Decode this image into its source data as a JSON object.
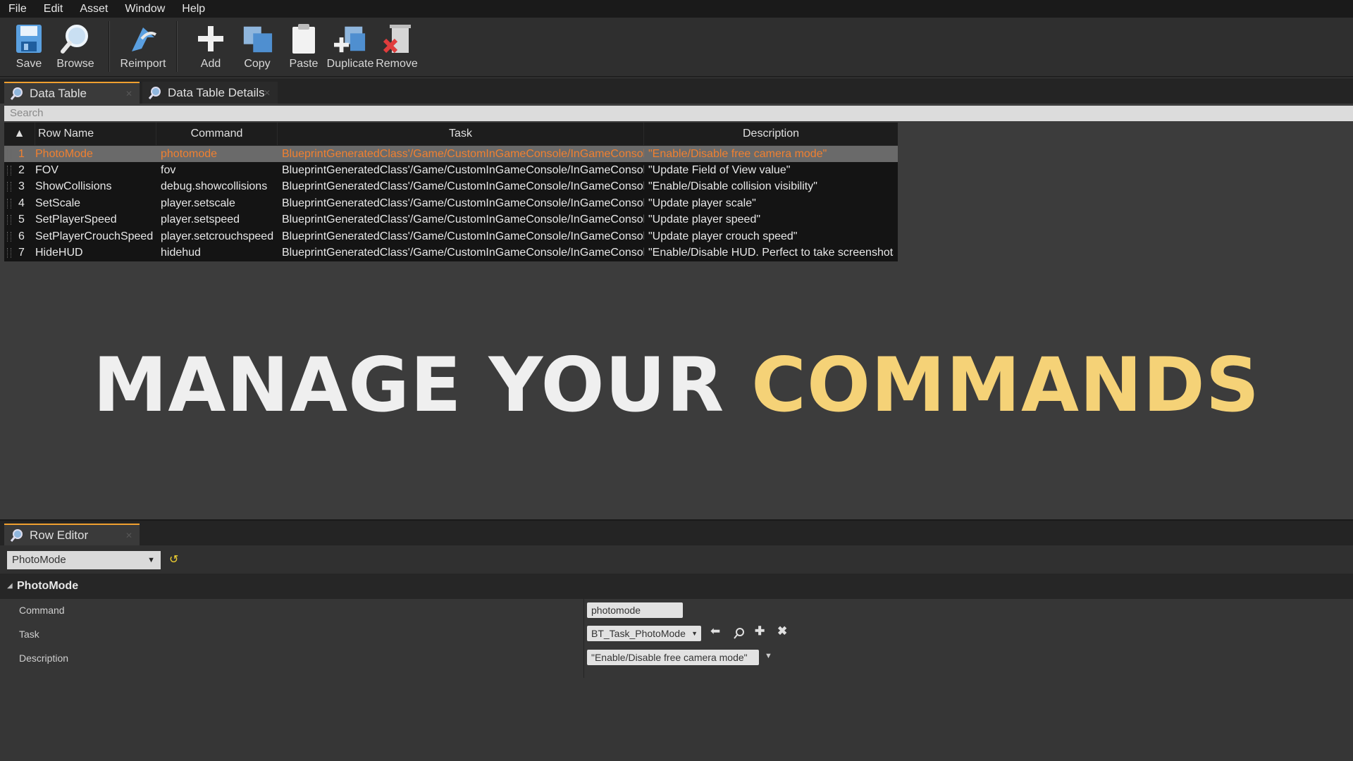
{
  "menu": [
    "File",
    "Edit",
    "Asset",
    "Window",
    "Help"
  ],
  "toolbar": {
    "save": "Save",
    "browse": "Browse",
    "reimport": "Reimport",
    "add": "Add",
    "copy": "Copy",
    "paste": "Paste",
    "duplicate": "Duplicate",
    "remove": "Remove"
  },
  "tabs": {
    "data_table": "Data Table",
    "data_table_details": "Data Table Details"
  },
  "search": {
    "placeholder": "Search"
  },
  "table": {
    "headers": [
      "Row Name",
      "Command",
      "Task",
      "Description"
    ],
    "rows": [
      {
        "n": "1",
        "name": "PhotoMode",
        "command": "photomode",
        "task": "BlueprintGeneratedClass'/Game/CustomInGameConsole/InGameConsole",
        "description": "\"Enable/Disable free camera mode\""
      },
      {
        "n": "2",
        "name": "FOV",
        "command": "fov",
        "task": "BlueprintGeneratedClass'/Game/CustomInGameConsole/InGameConsole",
        "description": "\"Update Field of View value\""
      },
      {
        "n": "3",
        "name": "ShowCollisions",
        "command": "debug.showcollisions",
        "task": "BlueprintGeneratedClass'/Game/CustomInGameConsole/InGameConsole",
        "description": "\"Enable/Disable collision visibility\""
      },
      {
        "n": "4",
        "name": "SetScale",
        "command": "player.setscale",
        "task": "BlueprintGeneratedClass'/Game/CustomInGameConsole/InGameConsole",
        "description": "\"Update player scale\""
      },
      {
        "n": "5",
        "name": "SetPlayerSpeed",
        "command": "player.setspeed",
        "task": "BlueprintGeneratedClass'/Game/CustomInGameConsole/InGameConsole",
        "description": "\"Update player speed\""
      },
      {
        "n": "6",
        "name": "SetPlayerCrouchSpeed",
        "command": "player.setcrouchspeed",
        "task": "BlueprintGeneratedClass'/Game/CustomInGameConsole/InGameConsole",
        "description": "\"Update player crouch speed\""
      },
      {
        "n": "7",
        "name": "HideHUD",
        "command": "hidehud",
        "task": "BlueprintGeneratedClass'/Game/CustomInGameConsole/InGameConsole",
        "description": "\"Enable/Disable HUD. Perfect to take screenshots\""
      }
    ]
  },
  "headline": {
    "part1": "MANAGE YOUR ",
    "part2": "COMMANDS"
  },
  "row_editor": {
    "tab": "Row Editor",
    "selected_row": "PhotoMode",
    "section": "PhotoMode",
    "labels": {
      "command": "Command",
      "task": "Task",
      "description": "Description"
    },
    "values": {
      "command": "photomode",
      "task": "BT_Task_PhotoMode",
      "description": "\"Enable/Disable free camera mode\""
    }
  },
  "colors": {
    "selected_row_text": "#f08030",
    "accent_tab": "#f0a030",
    "headline_accent": "#f5d277"
  }
}
